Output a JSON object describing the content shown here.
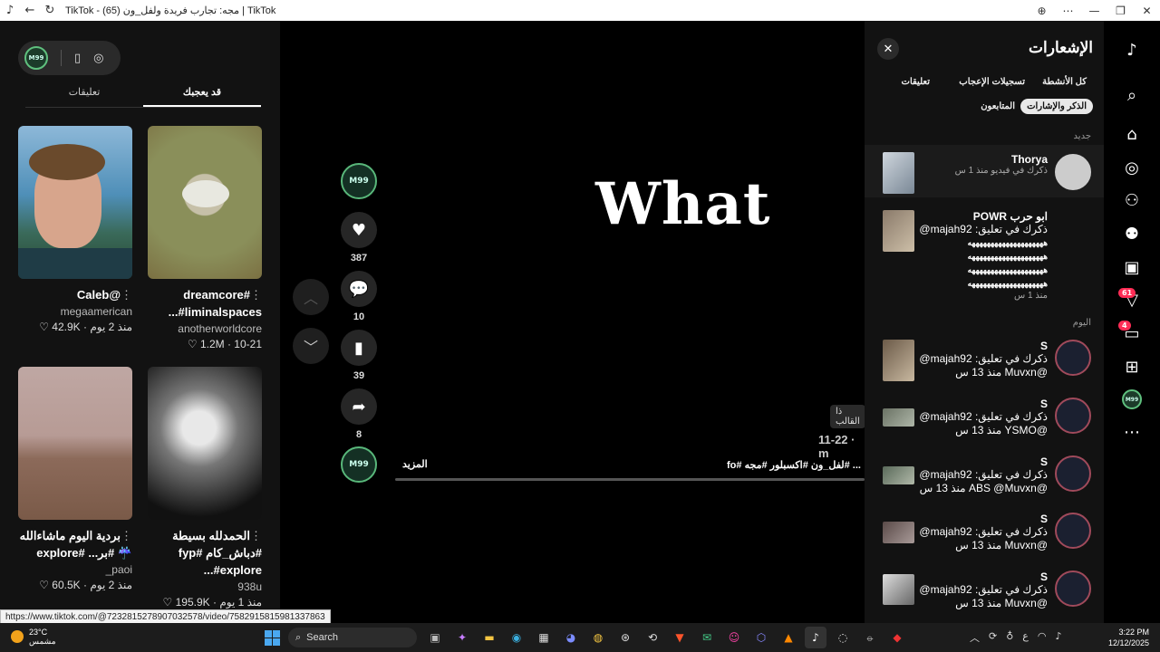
{
  "window": {
    "title": "TikTok - (65) مجه: تجارب فريدة ولفل_ون | TikTok"
  },
  "left_panel": {
    "tabs": [
      {
        "label": "تعليقات"
      },
      {
        "label": "قد يعجبك"
      }
    ],
    "cards": [
      {
        "caption": "@Caleb",
        "author": "megaamerican",
        "likes": "42.9K",
        "age": "منذ 2 يوم"
      },
      {
        "caption": "#dreamcore #liminalspaces...",
        "author": "anotherworldcore",
        "likes": "1.2M",
        "age": "10-21"
      },
      {
        "caption": "بردية اليوم ماشاءالله ☔ #بر... #explore",
        "author": "_paoi",
        "likes": "60.5K",
        "age": "منذ 2 يوم"
      },
      {
        "caption": "الحمدلله بسيطة #دباش_كام #fyp #explore...",
        "author": "938u",
        "likes": "195.9K",
        "age": "منذ 1 يوم"
      }
    ]
  },
  "video": {
    "overlay_text": "What",
    "likes": "387",
    "comments": "10",
    "saves": "39",
    "shares": "8",
    "chip": "ذا القالب",
    "date": "11-22 · m",
    "more": "المزيد",
    "description": "... #لفل_ون #اكسبلور #مجه #fo"
  },
  "notifications": {
    "title": "الإشعارات",
    "filters": [
      "كل الأنشطة",
      "تسجيلات الإعجاب",
      "تعليقات",
      "الذكر والإشارات",
      "المتابعون"
    ],
    "section_new": "جديد",
    "section_today": "اليوم",
    "items": [
      {
        "name": "Thorya",
        "line1": "ذكرك في فيديو منذ 1 س",
        "line2": ""
      },
      {
        "name": "ابو حرب POWR",
        "line1": "ذكرك في تعليق: majah92@",
        "line2": "منذ 1 س"
      },
      {
        "name": "S",
        "line1": "ذكرك في تعليق: majah92@",
        "line2": "@Muvxn منذ 13 س"
      },
      {
        "name": "S",
        "line1": "ذكرك في تعليق: majah92@",
        "line2": "@YSMO منذ 13 س"
      },
      {
        "name": "S",
        "line1": "ذكرك في تعليق: majah92@",
        "line2": "@ABS @Muvxn منذ 13 س"
      },
      {
        "name": "S",
        "line1": "ذكرك في تعليق: majah92@",
        "line2": "@Muvxn منذ 13 س"
      },
      {
        "name": "S",
        "line1": "ذكرك في تعليق: majah92@",
        "line2": "@Muvxn منذ 13 س"
      }
    ],
    "hash_line": "ههههههههههههههههههههه"
  },
  "rail": {
    "badge_inbox": "61",
    "badge_messages": "4"
  },
  "statusbar": {
    "url": "https://www.tiktok.com/@7232815278907032578/video/7582915815981337863"
  },
  "taskbar": {
    "temp": "23°C",
    "weather": "مشمس",
    "search": "Search",
    "time": "3:22 PM",
    "date": "12/12/2025"
  }
}
